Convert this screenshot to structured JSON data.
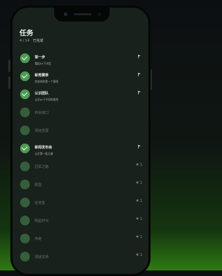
{
  "header": {
    "title": "任务"
  },
  "summary": {
    "progress": "4 / 14",
    "done_label": "已完成"
  },
  "tasks": [
    {
      "label": "第一步",
      "sub": "看起Se下决定",
      "done": true,
      "marker": "flag"
    },
    {
      "label": "新秀赛季",
      "sub": "完成你的第一个赛季",
      "done": true,
      "marker": "flag"
    },
    {
      "label": "认识团队",
      "sub": "认识te下不同的角色",
      "done": true,
      "marker": "flag"
    },
    {
      "label": "转会窗口",
      "sub": "",
      "done": false,
      "marker": "none"
    },
    {
      "label": "球迷发展",
      "sub": "",
      "done": false,
      "marker": "none"
    },
    {
      "label": "新闻发布会",
      "sub": "认识第一批记者",
      "done": true,
      "marker": "flag"
    },
    {
      "label": "冠军之路",
      "sub": "",
      "done": false,
      "marker": "star",
      "star_text": "1"
    },
    {
      "label": "联盟",
      "sub": "",
      "done": false,
      "marker": "star",
      "star_text": "1"
    },
    {
      "label": "名将堂",
      "sub": "",
      "done": false,
      "marker": "star",
      "star_text": "1"
    },
    {
      "label": "明星时代",
      "sub": "",
      "done": false,
      "marker": "star",
      "star_text": "1"
    },
    {
      "label": "传奇",
      "sub": "",
      "done": false,
      "marker": "star",
      "star_text": "1"
    },
    {
      "label": "球迷支持",
      "sub": "",
      "done": false,
      "marker": "star",
      "star_text": "1"
    }
  ],
  "icons": {
    "check": "checkmark-icon",
    "flag": "flag-icon",
    "star": "star-icon"
  },
  "colors": {
    "accent": "#4e9b54",
    "background": "#19211c"
  }
}
